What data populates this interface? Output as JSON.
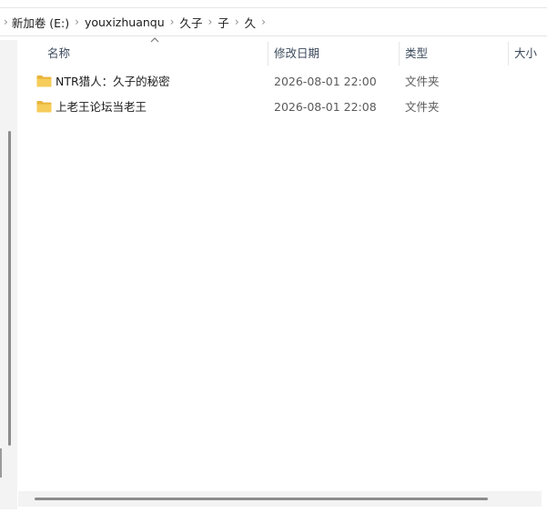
{
  "breadcrumb": {
    "items": [
      {
        "label": "新加卷 (E:)"
      },
      {
        "label": "youxizhuanqu"
      },
      {
        "label": "久子"
      },
      {
        "label": "子"
      },
      {
        "label": "久"
      }
    ],
    "separator": "›"
  },
  "columns": {
    "name": "名称",
    "date": "修改日期",
    "type": "类型",
    "size": "大小"
  },
  "sort": {
    "column": "name",
    "direction": "ascending"
  },
  "files": [
    {
      "name": "NTR猎人：久子的秘密",
      "date": "2026-08-01 22:00",
      "type": "文件夹",
      "icon": "folder-icon"
    },
    {
      "name": "上老王论坛当老王",
      "date": "2026-08-01 22:08",
      "type": "文件夹",
      "icon": "folder-icon"
    }
  ],
  "colors": {
    "folder": "#f0c04a",
    "header_text": "#3c4a5c",
    "scrollbar": "#8c8c8c"
  }
}
